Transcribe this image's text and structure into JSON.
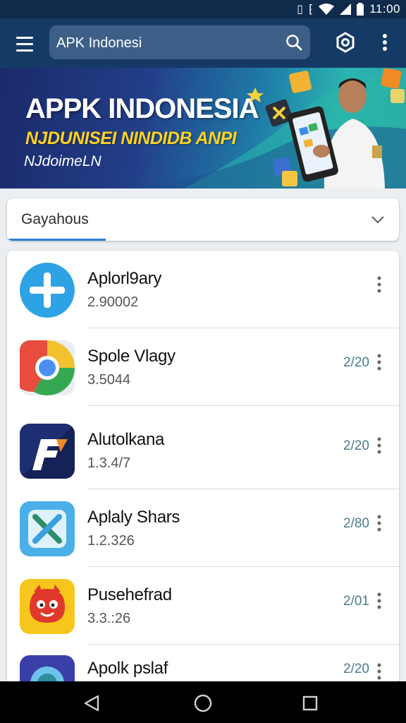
{
  "status_bar": {
    "time": "11:00",
    "icons": [
      "sim-icon",
      "vibrate-icon",
      "wifi-icon",
      "signal-icon",
      "battery-icon"
    ]
  },
  "app_bar": {
    "menu_icon": "hamburger-menu-icon",
    "search_value": "APK Indonesi",
    "search_icon": "search-icon",
    "settings_icon": "settings-hexagon-icon",
    "overflow_icon": "more-vertical-icon"
  },
  "banner": {
    "title": "APPK INDONESIA",
    "subtitle": "NJDUNISEI NINDIDB ANPI",
    "caption": "NJdoimeLN"
  },
  "dropdown": {
    "value": "Gayahous",
    "accent": "#2a7fd4"
  },
  "apps": [
    {
      "name": "Aplorl9ary",
      "version": "2.90002",
      "date": "",
      "icon": "blue-cross-icon"
    },
    {
      "name": "Spole Vlagy",
      "version": "3.5044",
      "date": "2/20",
      "icon": "chrome-icon"
    },
    {
      "name": "Alutolkana",
      "version": "1.3.4/7",
      "date": "2/20",
      "icon": "f-logo-icon"
    },
    {
      "name": "Aplaly Shars",
      "version": "1.2.326",
      "date": "2/80",
      "icon": "x-arrow-icon"
    },
    {
      "name": "Pusehefrad",
      "version": "3.3.:26",
      "date": "2/01",
      "icon": "red-mascot-icon"
    },
    {
      "name": "Apolk pslaf",
      "version": "",
      "date": "2/20",
      "icon": "purple-circle-icon"
    }
  ],
  "nav_bar": {
    "back_icon": "back-triangle-icon",
    "home_icon": "home-circle-icon",
    "recents_icon": "recents-square-icon"
  },
  "colors": {
    "status_bar": "#0f2a4a",
    "app_bar": "#163a66",
    "banner_title": "#ffffff",
    "banner_subtitle": "#ffd21f",
    "date_text": "#4a7c8a"
  }
}
